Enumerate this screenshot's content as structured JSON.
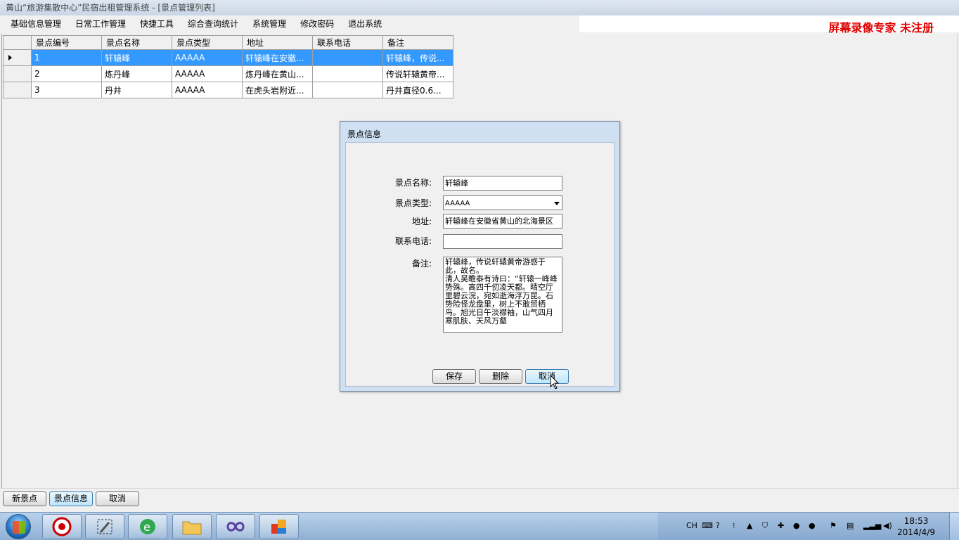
{
  "window": {
    "title": "黄山“旅游集散中心”民宿出租管理系统 - [景点管理列表]"
  },
  "menu": [
    "基础信息管理",
    "日常工作管理",
    "快捷工具",
    "综合查询统计",
    "系统管理",
    "修改密码",
    "退出系统"
  ],
  "watermark": "屏幕录像专家 未注册",
  "grid": {
    "columns": [
      "景点编号",
      "景点名称",
      "景点类型",
      "地址",
      "联系电话",
      "备注"
    ],
    "rows": [
      {
        "id": "1",
        "name": "轩辕峰",
        "type": "AAAAA",
        "address": "轩辕峰在安徽...",
        "phone": "",
        "note": "轩辕峰，传说...",
        "selected": true
      },
      {
        "id": "2",
        "name": "炼丹峰",
        "type": "AAAAA",
        "address": "炼丹峰在黄山...",
        "phone": "",
        "note": "传说轩辕黄帝...",
        "selected": false
      },
      {
        "id": "3",
        "name": "丹井",
        "type": "AAAAA",
        "address": "在虎头岩附近...",
        "phone": "",
        "note": "丹井直径0.6...",
        "selected": false
      }
    ]
  },
  "dialog": {
    "title": "景点信息",
    "labels": {
      "name": "景点名称:",
      "type": "景点类型:",
      "address": "地址:",
      "phone": "联系电话:",
      "note": "备注:"
    },
    "values": {
      "name": "轩辕峰",
      "type": "AAAAA",
      "address": "轩辕峰在安徽省黄山的北海景区",
      "phone": "",
      "note": "轩辕峰，传说轩辕黄帝游感于此，故名。\n清人吴瞻泰有诗曰：“轩辕一峰峰势殊。高四千仞凌天都。晴空厅里碧云浣，宛如逝海浮万昆。石势险怪龙盘里，树上不敢贸栖鸟。旭光日午淡襟袖，山气四月寒肌肤、天风万壑"
    },
    "buttons": {
      "save": "保存",
      "delete": "删除",
      "cancel": "取消"
    }
  },
  "bottom": {
    "new": "新景点",
    "info": "景点信息",
    "cancel": "取消"
  },
  "tray": {
    "lang": "CH",
    "time": "18:53",
    "date": "2014/4/9"
  }
}
